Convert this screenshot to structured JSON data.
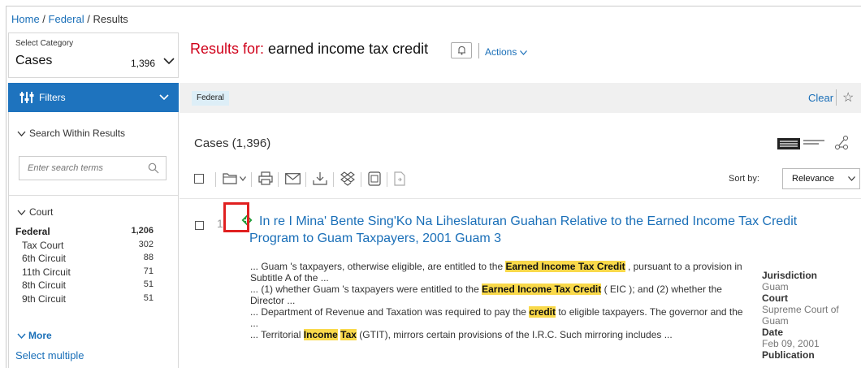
{
  "breadcrumb": {
    "home": "Home",
    "sep": " / ",
    "federal": "Federal",
    "results": "Results"
  },
  "category": {
    "label": "Select Category",
    "value": "Cases",
    "count": "1,396"
  },
  "filters": {
    "label": "Filters"
  },
  "search_within": {
    "label": "Search Within Results",
    "placeholder": "Enter search terms"
  },
  "court": {
    "label": "Court",
    "items": [
      {
        "label": "Federal",
        "count": "1,206"
      },
      {
        "label": "Tax Court",
        "count": "302"
      },
      {
        "label": "6th Circuit",
        "count": "88"
      },
      {
        "label": "11th Circuit",
        "count": "71"
      },
      {
        "label": "8th Circuit",
        "count": "51"
      },
      {
        "label": "9th Circuit",
        "count": "51"
      }
    ],
    "more_label": "More",
    "select_multiple": "Select multiple"
  },
  "header": {
    "results_prefix": "Results for:",
    "query": "earned income tax credit",
    "actions_label": "Actions"
  },
  "facet": {
    "chip": "Federal",
    "clear": "Clear"
  },
  "results": {
    "heading": "Cases (1,396)",
    "sort_label": "Sort by:",
    "sort_value": "Relevance"
  },
  "result": {
    "number": "1.",
    "title": "In re I Mina' Bente Sing'Ko Na Liheslaturan Guahan Relative to the Earned Income Tax Credit Program to Guam Taxpayers, 2001 Guam 3",
    "snippets": [
      {
        "a": "... Guam 's taxpayers, otherwise eligible, are entitled to the ",
        "hl": "Earned Income Tax Credit",
        "b": " , pursuant to a provision in Subtitle A of the ..."
      },
      {
        "a": "... (1) whether Guam 's taxpayers were entitled to the ",
        "hl": "Earned Income Tax Credit",
        "b": " ( EIC ); and (2) whether the Director ..."
      },
      {
        "a": "... Department of Revenue and Taxation was required to pay the ",
        "hl": "credit",
        "b": " to eligible taxpayers. The governor and the ..."
      },
      {
        "a": "... Territorial ",
        "hl": "Income",
        "mid": " ",
        "hl2": "Tax",
        "b": " (GTIT), mirrors certain provisions of the I.R.C. Such mirroring includes ..."
      }
    ],
    "meta": {
      "jurisdiction_label": "Jurisdiction",
      "jurisdiction": "Guam",
      "court_label": "Court",
      "court": "Supreme Court of Guam",
      "date_label": "Date",
      "date": "Feb 09, 2001",
      "publication_label": "Publication"
    }
  },
  "colors": {
    "brand_blue": "#1e73be",
    "link": "#1a6fb8",
    "red": "#d0021b",
    "highlight": "#f9d94a",
    "diamond_green": "#1f9d3a"
  },
  "icons": [
    "filter-sliders-icon",
    "chevron-down-icon",
    "search-icon",
    "bell-icon",
    "star-icon",
    "folder-icon",
    "print-icon",
    "email-icon",
    "download-icon",
    "dropbox-icon",
    "copy-icon",
    "export-icon",
    "list-view-icon",
    "compact-view-icon",
    "graph-view-icon",
    "diamond-icon"
  ]
}
